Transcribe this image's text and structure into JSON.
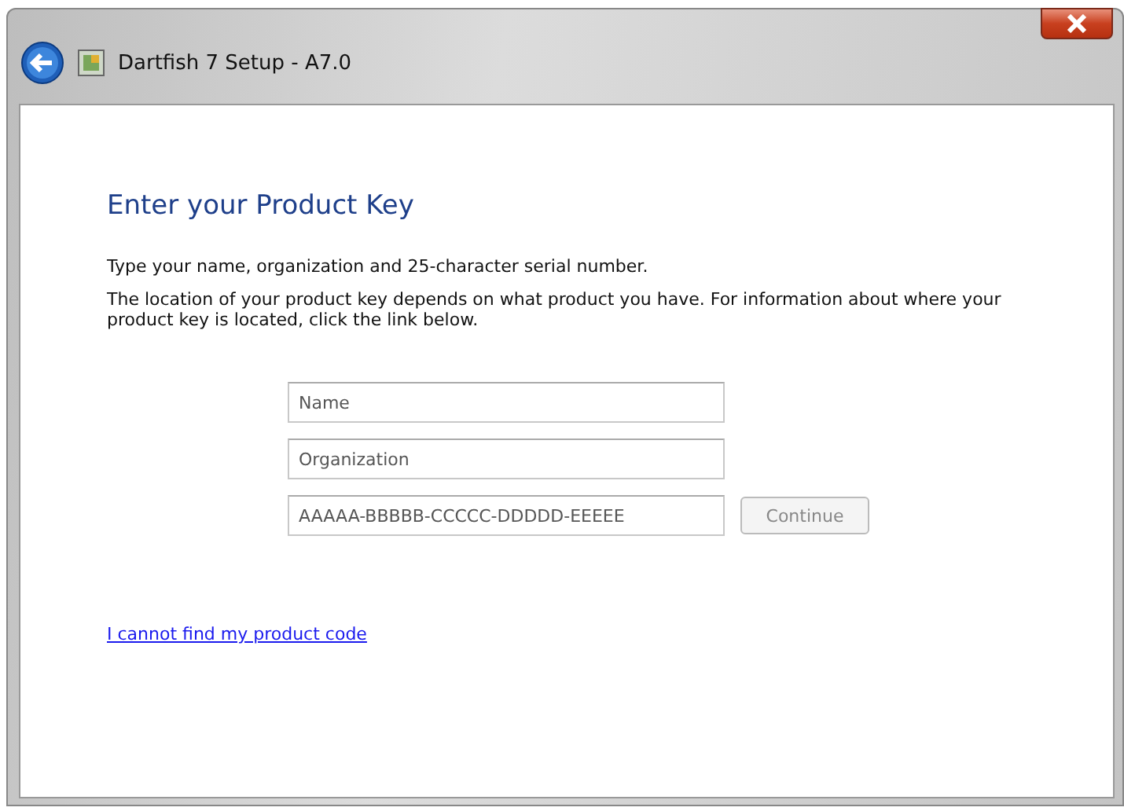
{
  "window": {
    "title": "Dartfish 7 Setup - A7.0"
  },
  "heading": "Enter your Product Key",
  "paragraphs": [
    "Type your name, organization and 25-character serial number.",
    "The location of your product key depends on what product you have. For information about where your product key is located, click the link below."
  ],
  "fields": [
    {
      "placeholder": "Name"
    },
    {
      "placeholder": "Organization"
    },
    {
      "placeholder": "AAAAA-BBBBB-CCCCC-DDDDD-EEEEE"
    }
  ],
  "continue_button": {
    "label": "Continue",
    "disabled": true
  },
  "link": "I cannot find my product code"
}
